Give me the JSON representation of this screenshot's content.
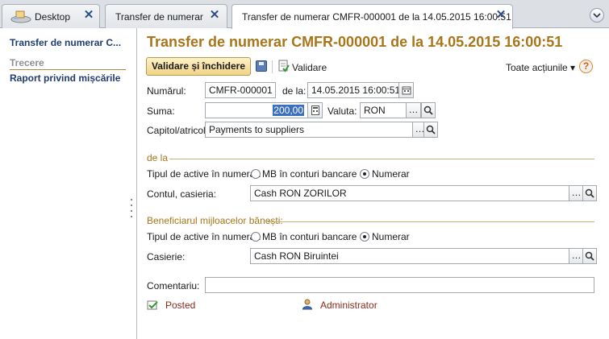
{
  "tabs": [
    {
      "label": "Desktop"
    },
    {
      "label": "Transfer de numerar"
    },
    {
      "label": "Transfer de numerar CMFR-000001 de la 14.05.2015 16:00:51"
    }
  ],
  "sidebar": {
    "items": [
      {
        "label": "Transfer de numerar C..."
      },
      {
        "label": "Trecere"
      },
      {
        "label": "Raport privind mișcările"
      }
    ]
  },
  "form": {
    "title": "Transfer de numerar CMFR-000001 de la 14.05.2015 16:00:51",
    "toolbar": {
      "validate_close": "Validare și închidere",
      "validate": "Validare",
      "all_actions": "Toate acțiunile ▾",
      "help": "?"
    },
    "number": {
      "label": "Numărul:",
      "value": "CMFR-000001"
    },
    "date": {
      "label": "de la:",
      "value": "14.05.2015 16:00:51"
    },
    "amount": {
      "label": "Suma:",
      "value": "200,00"
    },
    "currency": {
      "label": "Valuta:",
      "value": "RON"
    },
    "article": {
      "label": "Capitol/atricol:",
      "value": "Payments to suppliers"
    },
    "from": {
      "group": "de la",
      "asset_type_label": "Tipul de active în numerar:",
      "option_bank": "MB în conturi bancare",
      "option_cash": "Numerar",
      "selected": "Numerar",
      "account_label": "Contul, casieria:",
      "account_value": "Cash RON ZORILOR"
    },
    "to": {
      "group": "Beneficiarul mijloacelor bănești:",
      "asset_type_label": "Tipul de active în numerar:",
      "option_bank": "MB în conturi bancare",
      "option_cash": "Numerar",
      "selected": "Numerar",
      "account_label": "Casierie:",
      "account_value": "Cash RON Biruintei"
    },
    "comment": {
      "label": "Comentariu:",
      "value": ""
    },
    "status": "Posted",
    "author": "Administrator"
  },
  "colors": {
    "title": "#a8761a",
    "sidebar_link": "#1f3c72",
    "status": "#8b2a1a"
  }
}
